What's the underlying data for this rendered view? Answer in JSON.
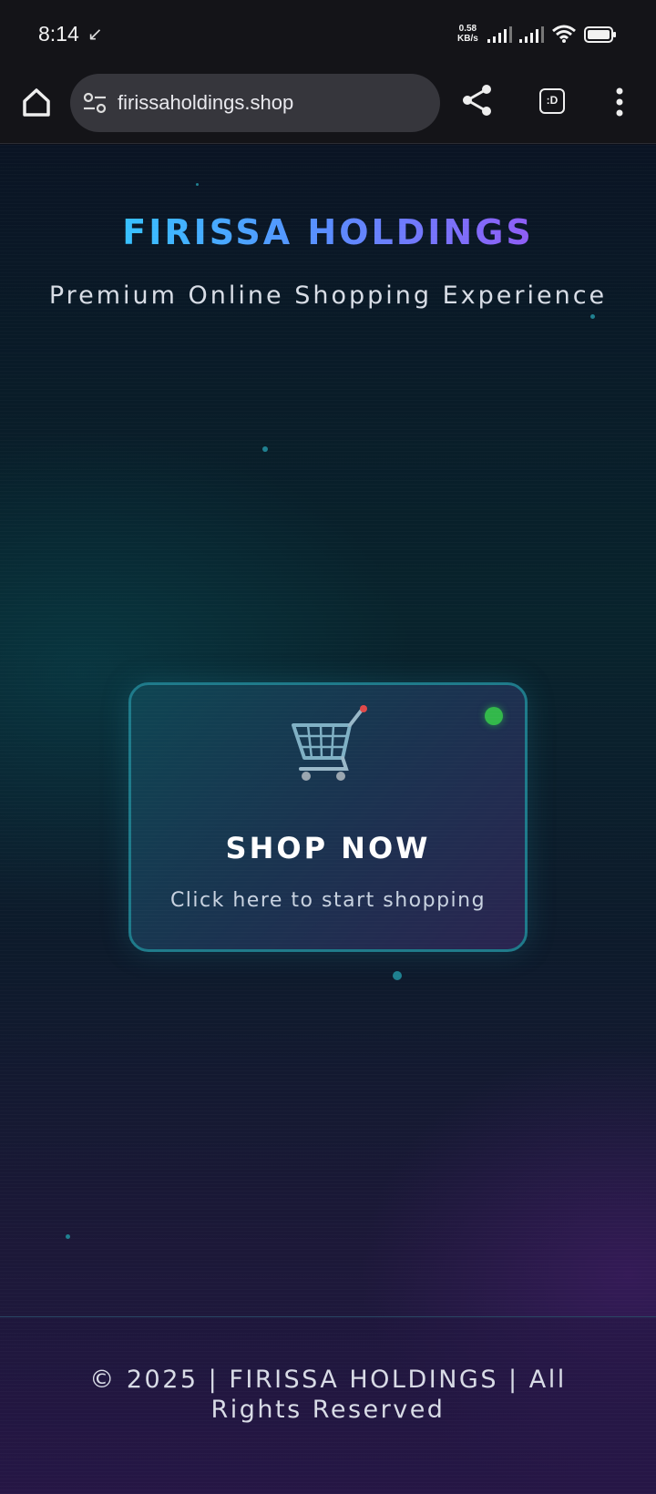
{
  "status_bar": {
    "time": "8:14",
    "net_speed_value": "0.58",
    "net_speed_unit": "KB/s"
  },
  "browser": {
    "url": "firissaholdings.shop",
    "tabs_label": ":D"
  },
  "header": {
    "title": "FIRISSA HOLDINGS",
    "tagline": "Premium Online Shopping Experience"
  },
  "shop_card": {
    "title": "SHOP NOW",
    "subtitle": "Click here to start shopping",
    "status_color": "#32b84a"
  },
  "footer": {
    "text": "© 2025 | FIRISSA HOLDINGS | All Rights Reserved"
  },
  "icons": {
    "cart": "shopping-cart-icon",
    "home": "home-icon",
    "share": "share-icon",
    "menu": "more-vertical-icon"
  },
  "colors": {
    "accent_cyan": "#22e0ff",
    "accent_purple": "#b040f0",
    "card_border": "#1e7a8a"
  }
}
